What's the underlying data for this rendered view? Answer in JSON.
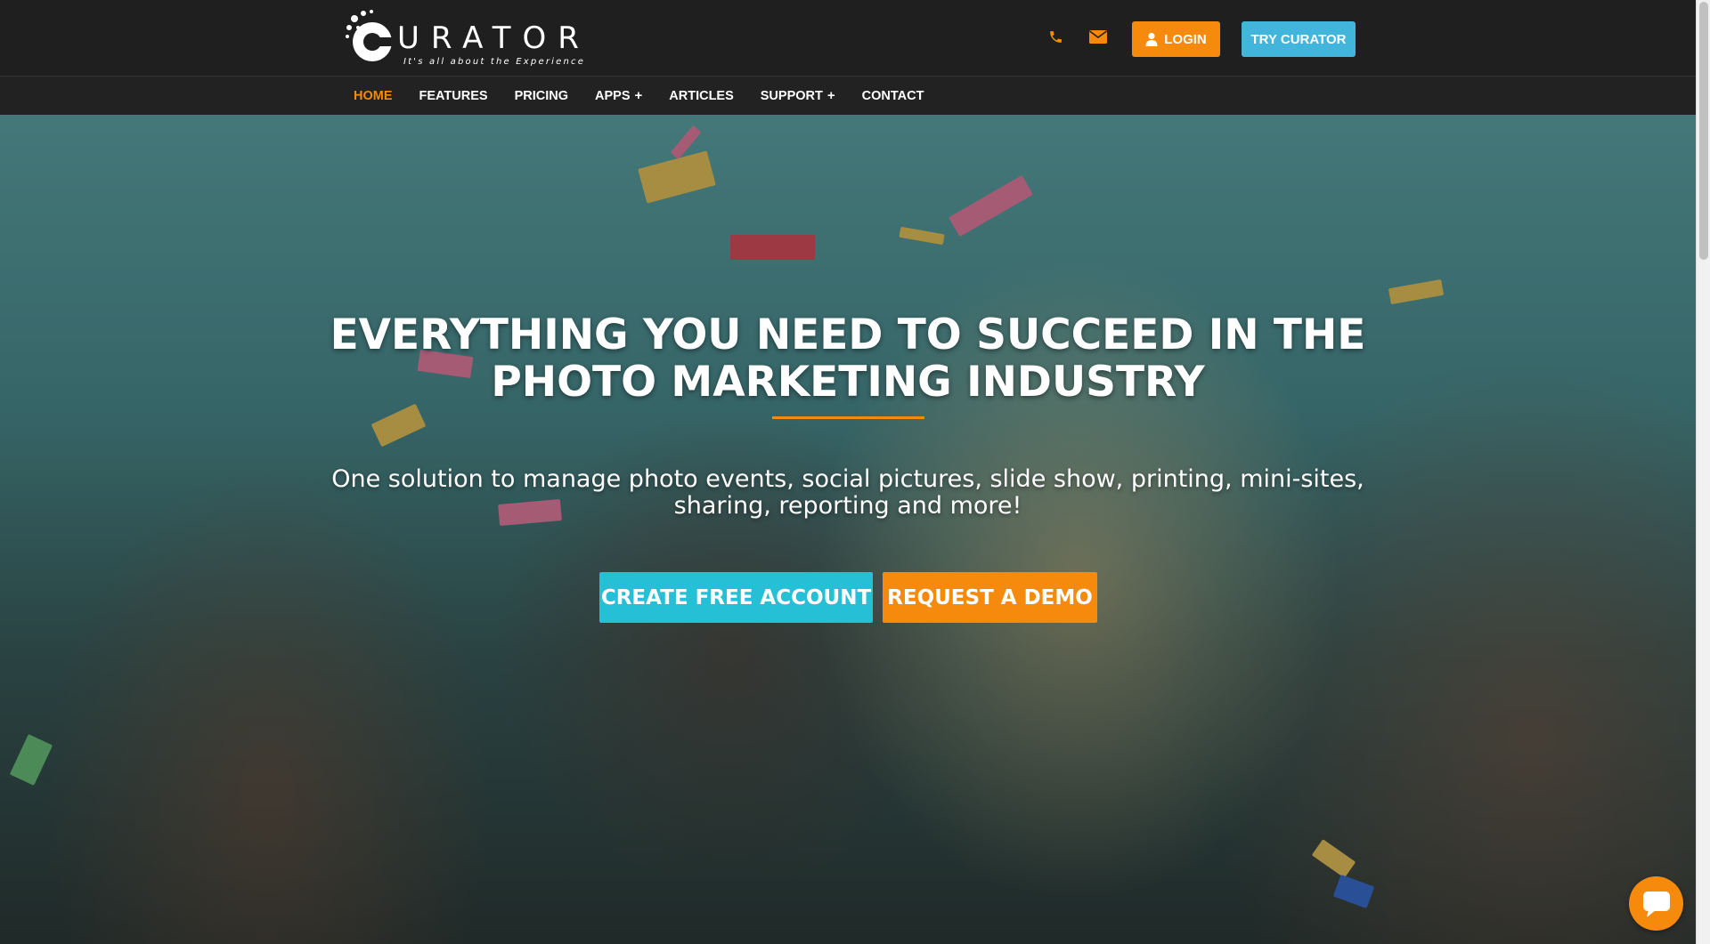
{
  "header": {
    "logo_text": "URATOR",
    "logo_letter": "C",
    "logo_tagline": "It's all about the Experience",
    "phone_icon": "phone-icon",
    "mail_icon": "envelope-icon",
    "login_label": "LOGIN",
    "try_label": "TRY CURATOR"
  },
  "nav": {
    "items": [
      {
        "label": "HOME",
        "active": true,
        "has_submenu": false
      },
      {
        "label": "FEATURES",
        "active": false,
        "has_submenu": false
      },
      {
        "label": "PRICING",
        "active": false,
        "has_submenu": false
      },
      {
        "label": "APPS",
        "active": false,
        "has_submenu": true
      },
      {
        "label": "ARTICLES",
        "active": false,
        "has_submenu": false
      },
      {
        "label": "SUPPORT",
        "active": false,
        "has_submenu": true
      },
      {
        "label": "CONTACT",
        "active": false,
        "has_submenu": false
      }
    ],
    "submenu_marker": "+"
  },
  "hero": {
    "title_line1": "EVERYTHING YOU NEED TO SUCCEED IN THE",
    "title_line2": "PHOTO MARKETING INDUSTRY",
    "subtitle_line1": "One solution to manage photo events, social pictures, slide show, printing, mini-sites,",
    "subtitle_line2": "sharing, reporting and more!",
    "primary_cta": "CREATE FREE ACCOUNT",
    "secondary_cta": "REQUEST A DEMO"
  },
  "chat": {
    "icon": "chat-bubble-icon"
  },
  "colors": {
    "accent_orange": "#f58a0c",
    "accent_blue": "#41b5dc",
    "accent_teal": "#26c0d6",
    "header_bg": "#1f1f1f"
  }
}
